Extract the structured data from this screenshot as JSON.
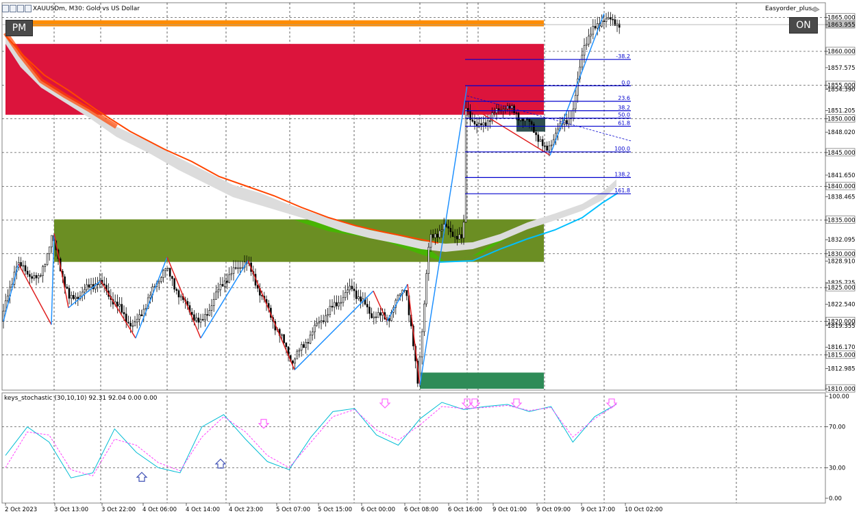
{
  "header": {
    "symbol_title": "XAUUSDm, M30:  Gold vs US Dollar",
    "ea_name": "Easyorder_plus",
    "pm_label": "PM",
    "on_label": "ON"
  },
  "indicator": {
    "title": "keys_stochastic (30,10,10) 92.31 92.04 0.00 0.00"
  },
  "colors": {
    "orange_zone": "#ff8c00",
    "red_zone": "#dc143c",
    "olive_zone": "#6b8e23",
    "green_zone": "#2e8b57",
    "dark_zone": "#2f4f4f",
    "fib_lines": "#0000cd",
    "zigzag_up": "#1e90ff",
    "zigzag_down": "#e02020",
    "ma_orange": "#ff4500",
    "ma_cyan": "#00bfff",
    "stoch_main": "#00bcd4",
    "stoch_signal": "#ff40ff",
    "stoch_arrow": "#ff66ff",
    "stoch_arrow_up": "#3f51b5"
  },
  "chart_data": [
    {
      "type": "candlestick",
      "title": "XAUUSDm, M30:  Gold vs US Dollar",
      "ylim": [
        1809.8,
        1867.2
      ],
      "y_ticks": [
        "1865.000",
        "1863.955",
        "1860.000",
        "1857.575",
        "1855.000",
        "1854.390",
        "1851.205",
        "1850.000",
        "1848.020",
        "1845.000",
        "1841.650",
        "1840.000",
        "1838.465",
        "1835.000",
        "1832.095",
        "1830.000",
        "1828.910",
        "1825.725",
        "1825.000",
        "1822.540",
        "1820.000",
        "1819.355",
        "1816.170",
        "1815.000",
        "1812.985",
        "1810.000"
      ],
      "highlighted_ticks": [
        "1865.000",
        "1863.955",
        "1860.000",
        "1855.000",
        "1850.000",
        "1845.000",
        "1840.000",
        "1835.000",
        "1830.000",
        "1825.000",
        "1820.000",
        "1815.000",
        "1810.000"
      ],
      "current_price": 1863.955,
      "x_labels": [
        "2 Oct 2023",
        "3 Oct 13:00",
        "3 Oct 22:00",
        "4 Oct 06:00",
        "4 Oct 14:00",
        "4 Oct 23:00",
        "5 Oct 07:00",
        "5 Oct 15:00",
        "6 Oct 00:00",
        "6 Oct 08:00",
        "6 Oct 16:00",
        "9 Oct 01:00",
        "9 Oct 09:00",
        "9 Oct 17:00",
        "10 Oct 02:00"
      ],
      "zones": [
        {
          "name": "orange",
          "y1": 1863.7,
          "y2": 1864.6,
          "x_end_label": "9 Oct 09:00"
        },
        {
          "name": "red",
          "y1": 1850.6,
          "y2": 1861.1
        },
        {
          "name": "olive",
          "y1": 1828.8,
          "y2": 1835.1
        },
        {
          "name": "green",
          "y1": 1810.0,
          "y2": 1812.4
        },
        {
          "name": "dark",
          "y1": 1848.1,
          "y2": 1850.2
        }
      ],
      "fibonacci": {
        "levels": [
          "-38.2",
          "0.0",
          "23.6",
          "38.2",
          "50.0",
          "61.8",
          "100.0",
          "138.2",
          "161.8"
        ],
        "prices": [
          1858.8,
          1854.9,
          1852.6,
          1851.2,
          1850.1,
          1848.9,
          1845.1,
          1841.3,
          1838.9
        ]
      },
      "ohlc_sample": [
        {
          "t": "6 Oct 16:00",
          "open": 1830.0,
          "high": 1835.2,
          "low": 1829.6,
          "close": 1832.8
        },
        {
          "t": "9 Oct 01:00",
          "open": 1849.6,
          "high": 1854.2,
          "low": 1846.3,
          "close": 1851.0
        },
        {
          "t": "9 Oct 09:00",
          "open": 1848.5,
          "high": 1850.4,
          "low": 1844.4,
          "close": 1845.3
        },
        {
          "t": "9 Oct 17:00",
          "open": 1862.1,
          "high": 1865.5,
          "low": 1860.8,
          "close": 1864.7
        },
        {
          "t": "10 Oct 02:00",
          "open": 1864.4,
          "high": 1865.2,
          "low": 1863.6,
          "close": 1863.955
        }
      ]
    },
    {
      "type": "line",
      "title": "keys_stochastic (30,10,10) 92.31 92.04 0.00 0.00",
      "ylim": [
        0,
        100
      ],
      "y_ticks": [
        "100.00",
        "70.00",
        "30.00",
        "0.00"
      ],
      "series": [
        {
          "name": "main",
          "values": [
            42,
            70,
            55,
            20,
            25,
            68,
            45,
            30,
            25,
            70,
            82,
            58,
            36,
            28,
            60,
            85,
            88,
            62,
            52,
            78,
            94,
            87,
            90,
            92,
            85,
            90,
            55,
            80,
            92.31
          ]
        },
        {
          "name": "signal",
          "values": [
            30,
            65,
            62,
            28,
            22,
            58,
            52,
            35,
            27,
            60,
            80,
            65,
            42,
            30,
            55,
            80,
            87,
            67,
            57,
            72,
            90,
            88,
            89,
            91,
            86,
            89,
            60,
            78,
            92.04
          ]
        }
      ]
    }
  ]
}
